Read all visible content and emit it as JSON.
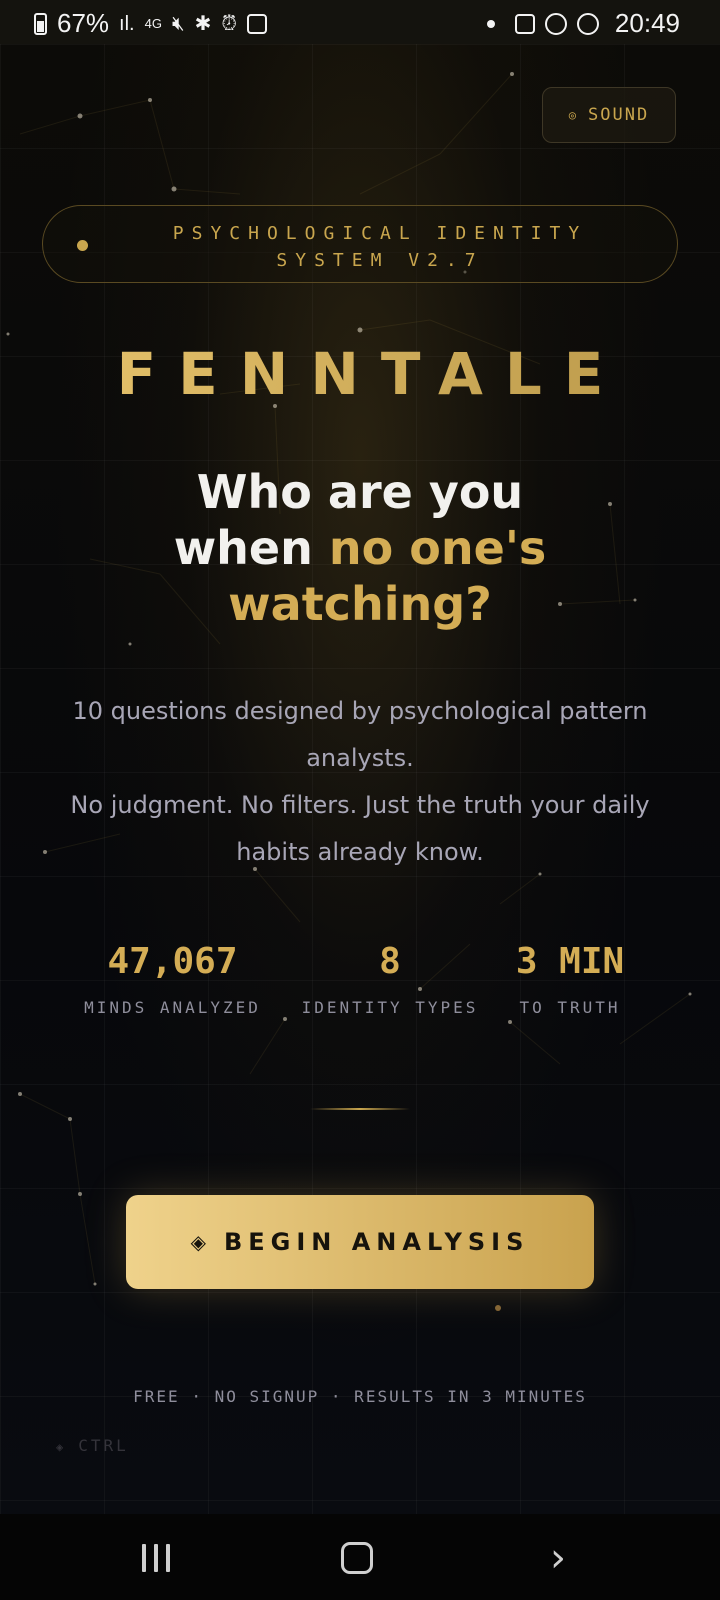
{
  "status_bar": {
    "battery": "67%",
    "network": "4G",
    "time": "20:49",
    "icons": [
      "battery-icon",
      "signal-icon",
      "network-4g-icon",
      "mute-icon",
      "bluetooth-icon",
      "alarm-icon",
      "save-icon",
      "notification-dot",
      "gallery-icon",
      "notification-icon",
      "notification-icon"
    ]
  },
  "sound_button": {
    "label": "SOUND",
    "icon": "radio-icon"
  },
  "badge": {
    "text": "PSYCHOLOGICAL IDENTITY SYSTEM V2.7"
  },
  "brand": "FENNTALE",
  "headline": {
    "line1": "Who are you",
    "line2_white": "when ",
    "line2_gold": "no one's",
    "line3_gold": "watching?"
  },
  "description": {
    "line1": "10 questions designed by psychological pattern analysts.",
    "line2": "No judgment. No filters. Just the truth your daily habits already know."
  },
  "stats": [
    {
      "value": "47,067",
      "label": "MINDS ANALYZED"
    },
    {
      "value": "8",
      "label": "IDENTITY TYPES"
    },
    {
      "value": "3 MIN",
      "label": "TO TRUTH"
    }
  ],
  "cta": {
    "label": "BEGIN ANALYSIS",
    "icon": "diamond-icon"
  },
  "footer_note": "FREE · NO SIGNUP · RESULTS IN 3 MINUTES",
  "ctrl": {
    "label": "CTRL",
    "icon": "diamond-icon"
  },
  "nav": {
    "recents": "recents-icon",
    "home": "home-icon",
    "back": "back-icon"
  },
  "colors": {
    "gold": "#d4ad55",
    "background": "#07080b",
    "muted": "#a8a6b6"
  }
}
